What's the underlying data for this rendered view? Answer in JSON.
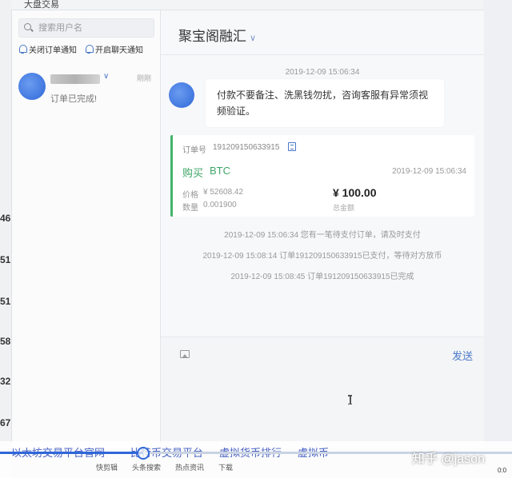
{
  "background": {
    "top_label": "大盘交易",
    "left_numbers": [
      "46",
      "51",
      "51",
      "58",
      "32",
      "67"
    ]
  },
  "sidebar": {
    "search_placeholder": "搜索用户名",
    "notify_orders": "关闭订单通知",
    "notify_chat": "开启聊天通知",
    "conversation": {
      "caret": "∨",
      "time": "刚刚",
      "message": "订单已完成!"
    }
  },
  "chat": {
    "title": "聚宝阁融汇",
    "title_caret": "∨",
    "first_timestamp": "2019-12-09 15:06:34",
    "bubble_text": "付款不要备注、洗黑钱勿扰，咨询客服有异常须视频验证。",
    "order": {
      "no_label": "订单号",
      "no": "191209150633915",
      "buy_label": "购买",
      "coin": "BTC",
      "time": "2019-12-09 15:06:34",
      "price_label": "价格",
      "price": "¥ 52608.42",
      "qty_label": "数量",
      "qty": "0.001900",
      "amount": "¥ 100.00",
      "amount_label": "总金额"
    },
    "system_messages": [
      "2019-12-09 15:06:34 您有一笔待支付订单，请及时支付",
      "2019-12-09 15:08:14 订单191209150633915已支付，等待对方放币",
      "2019-12-09 15:08:45 订单191209150633915已完成"
    ],
    "send_label": "发送"
  },
  "bottom": {
    "links": [
      "以太坊交易平台官网",
      "比特币交易平台",
      "虚拟货币排行",
      "虚拟币"
    ],
    "taskbar": [
      "快剪辑",
      "头条搜索",
      "热点资讯",
      "下载"
    ],
    "watermark": "知乎 @jason",
    "video_time": "0:0",
    "progress": 0.28
  },
  "colors": {
    "accent": "#4a78c8",
    "buy_green": "#3ea566",
    "progress_blue": "#2f67d8"
  }
}
